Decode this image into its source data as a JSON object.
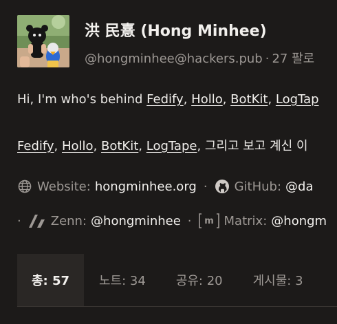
{
  "profile": {
    "display_name": "洪 民憙 (Hong Minhee)",
    "handle": "@hongminhee@hackers.pub",
    "separator": "·",
    "followers_fragment": "27 팔로",
    "bio_line1": {
      "prefix": "Hi, I'm who's behind ",
      "links": [
        "Fedify",
        "Hollo",
        "BotKit",
        "LogTap"
      ],
      "comma": ", "
    },
    "bio_line2": {
      "links": [
        "Fedify",
        "Hollo",
        "BotKit",
        "LogTape"
      ],
      "comma": ", ",
      "suffix": ", 그리고 보고 계신 이"
    },
    "fields": [
      {
        "label": "Website:",
        "value": "hongminhee.org",
        "icon": "globe-icon"
      },
      {
        "label": "GitHub:",
        "value": "@da",
        "icon": "github-icon"
      },
      {
        "label": "Zenn:",
        "value": "@hongminhee",
        "icon": "zenn-icon"
      },
      {
        "label": "Matrix:",
        "value": "@hongm",
        "icon": "matrix-icon"
      }
    ],
    "field_separator": "·"
  },
  "tabs": [
    {
      "label": "총: 57",
      "active": true
    },
    {
      "label": "노트: 34",
      "active": false
    },
    {
      "label": "공유: 20",
      "active": false
    },
    {
      "label": "게시물: 3",
      "active": false
    }
  ]
}
